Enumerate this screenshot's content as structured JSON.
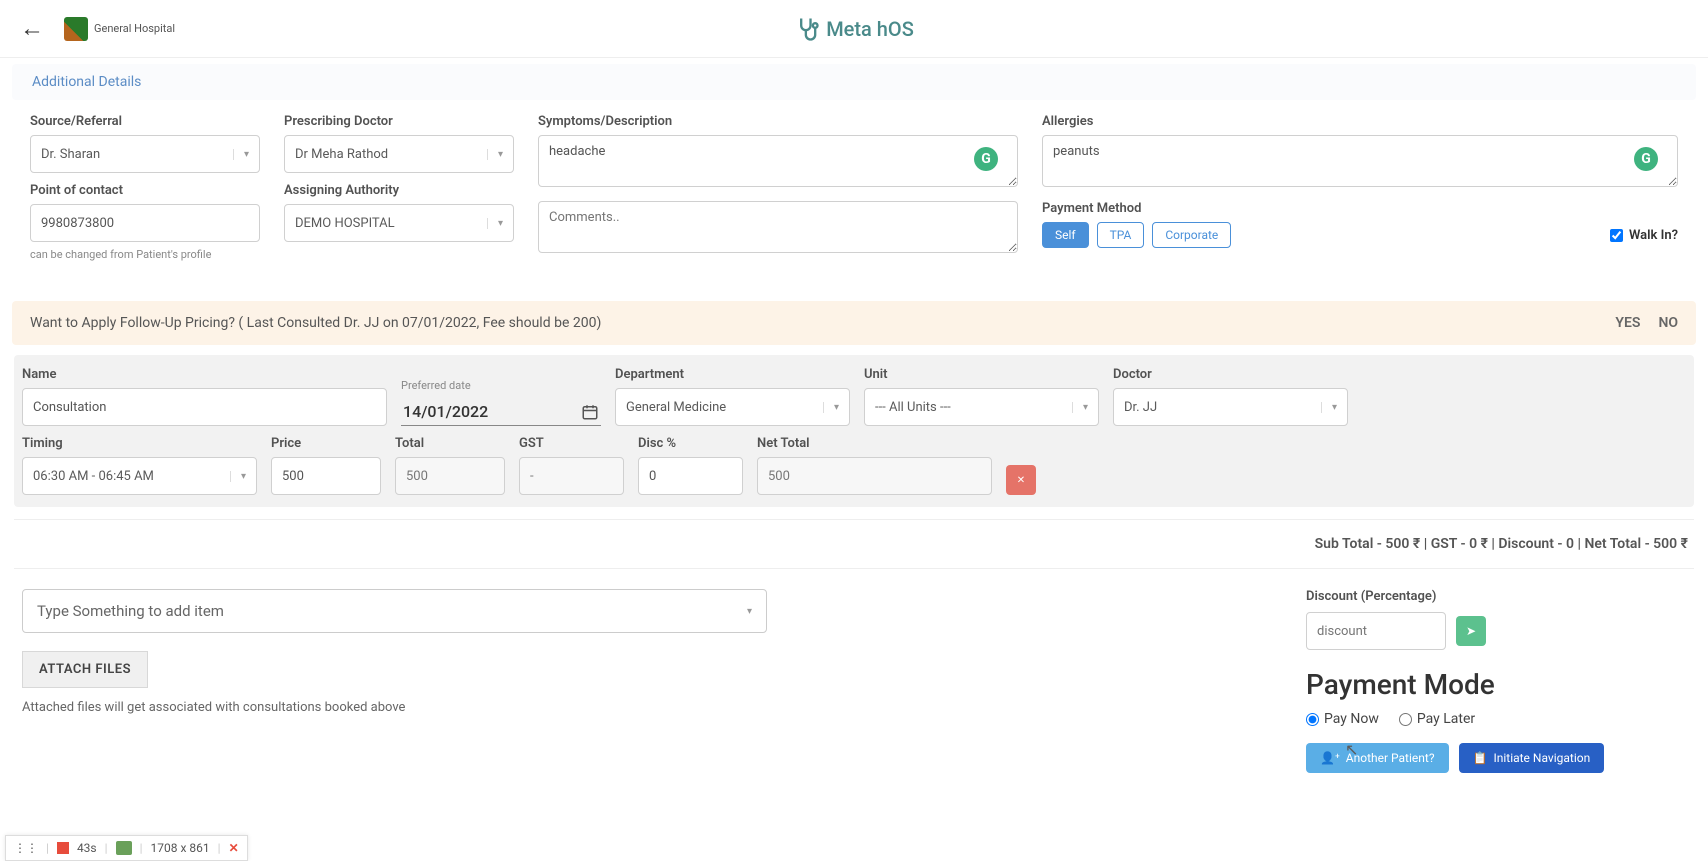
{
  "header": {
    "hospital_label": "General Hospital",
    "brand": "Meta hOS"
  },
  "sectionTitle": "Additional Details",
  "details": {
    "sourceReferral": {
      "label": "Source/Referral",
      "value": "Dr. Sharan"
    },
    "pointOfContact": {
      "label": "Point of contact",
      "value": "9980873800",
      "hint": "can be changed from Patient's profile"
    },
    "prescribingDoctor": {
      "label": "Prescribing Doctor",
      "value": "Dr Meha Rathod"
    },
    "assigningAuthority": {
      "label": "Assigning Authority",
      "value": "DEMO HOSPITAL"
    },
    "symptoms": {
      "label": "Symptoms/Description",
      "value": "headache",
      "comments_placeholder": "Comments.."
    },
    "allergies": {
      "label": "Allergies",
      "value": "peanuts"
    },
    "paymentMethod": {
      "label": "Payment Method",
      "self": "Self",
      "tpa": "TPA",
      "corporate": "Corporate"
    },
    "walkin": {
      "label": "Walk In?"
    }
  },
  "notice": {
    "text": "Want to Apply Follow-Up Pricing? ( Last Consulted Dr. JJ on 07/01/2022, Fee should be 200)",
    "yes": "YES",
    "no": "NO"
  },
  "item": {
    "name": {
      "label": "Name",
      "value": "Consultation"
    },
    "preferredDate": {
      "label": "Preferred date",
      "value": "14/01/2022"
    },
    "department": {
      "label": "Department",
      "value": "General Medicine"
    },
    "unit": {
      "label": "Unit",
      "value": "--- All Units ---"
    },
    "doctor": {
      "label": "Doctor",
      "value": "Dr. JJ"
    },
    "timing": {
      "label": "Timing",
      "value": "06:30 AM - 06:45 AM"
    },
    "price": {
      "label": "Price",
      "value": "500"
    },
    "total": {
      "label": "Total",
      "value": "500"
    },
    "gst": {
      "label": "GST",
      "value": "-"
    },
    "disc": {
      "label": "Disc %",
      "value": "0"
    },
    "netTotal": {
      "label": "Net Total",
      "value": "500"
    }
  },
  "summary": "Sub Total - 500 ₹ | GST - 0 ₹ | Discount - 0 | Net Total - 500 ₹",
  "addItemPlaceholder": "Type Something to add item",
  "attach": {
    "btn": "ATTACH FILES",
    "hint": "Attached files will get associated with consultations booked above"
  },
  "discount": {
    "label": "Discount (Percentage)",
    "placeholder": "discount"
  },
  "payMode": {
    "title": "Payment Mode",
    "now": "Pay Now",
    "later": "Pay Later"
  },
  "actions": {
    "another": "Another Patient?",
    "initiate": "Initiate Navigation"
  },
  "recorder": {
    "time": "43s",
    "dims": "1708 x 861"
  }
}
